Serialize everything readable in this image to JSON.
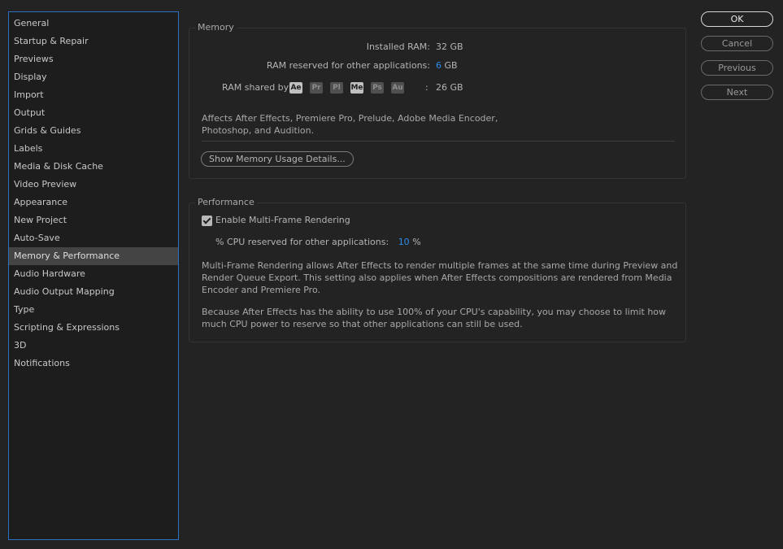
{
  "sidebar": {
    "items": [
      {
        "label": "General"
      },
      {
        "label": "Startup & Repair"
      },
      {
        "label": "Previews"
      },
      {
        "label": "Display"
      },
      {
        "label": "Import"
      },
      {
        "label": "Output"
      },
      {
        "label": "Grids & Guides"
      },
      {
        "label": "Labels"
      },
      {
        "label": "Media & Disk Cache"
      },
      {
        "label": "Video Preview"
      },
      {
        "label": "Appearance"
      },
      {
        "label": "New Project"
      },
      {
        "label": "Auto-Save"
      },
      {
        "label": "Memory & Performance"
      },
      {
        "label": "Audio Hardware"
      },
      {
        "label": "Audio Output Mapping"
      },
      {
        "label": "Type"
      },
      {
        "label": "Scripting & Expressions"
      },
      {
        "label": "3D"
      },
      {
        "label": "Notifications"
      }
    ],
    "selected": "Memory & Performance"
  },
  "memory": {
    "title": "Memory",
    "installed_label": "Installed RAM:",
    "installed_value": "32 GB",
    "reserved_label": "RAM reserved for other applications:",
    "reserved_value": "6",
    "reserved_unit": "GB",
    "shared_label": "RAM shared by",
    "apps": [
      {
        "abbr": "Ae",
        "active": true
      },
      {
        "abbr": "Pr",
        "active": false
      },
      {
        "abbr": "Pl",
        "active": false
      },
      {
        "abbr": "Me",
        "active": true
      },
      {
        "abbr": "Ps",
        "active": false
      },
      {
        "abbr": "Au",
        "active": false
      }
    ],
    "shared_sep": ":",
    "shared_value": "26 GB",
    "affects_line1": "Affects After Effects, Premiere Pro, Prelude, Adobe Media Encoder,",
    "affects_line2": "Photoshop, and Audition.",
    "details_button": "Show Memory Usage Details..."
  },
  "performance": {
    "title": "Performance",
    "mfr_label": "Enable Multi-Frame Rendering",
    "mfr_checked": true,
    "cpu_label": "% CPU reserved for other applications:",
    "cpu_value": "10",
    "cpu_unit": "%",
    "para1_line1": "Multi-Frame Rendering allows After Effects to render multiple frames at the same time during Preview and",
    "para1_line2": "Render Queue Export. This setting also applies when After Effects compositions are rendered from Media",
    "para1_line3": "Encoder and Premiere Pro.",
    "para2_line1": "Because After Effects has the ability to use 100% of your CPU's capability, you may choose to limit how",
    "para2_line2": "much CPU power to reserve so that other applications can still be used."
  },
  "buttons": {
    "ok": "OK",
    "cancel": "Cancel",
    "previous": "Previous",
    "next": "Next"
  },
  "colors": {
    "accent": "#2d8ceb",
    "sidebar_border": "#2d6fc0",
    "background": "#232323"
  }
}
